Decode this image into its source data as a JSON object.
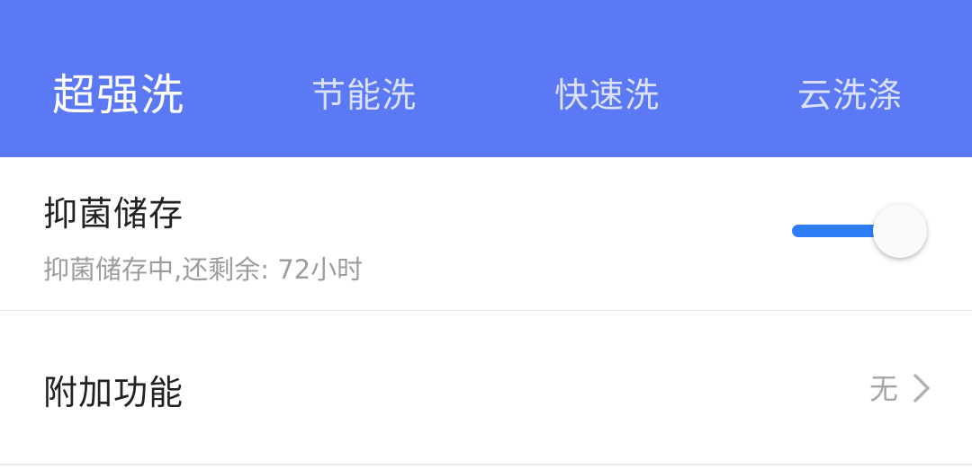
{
  "tabs": [
    {
      "label": "超强洗",
      "active": true
    },
    {
      "label": "节能洗",
      "active": false
    },
    {
      "label": "快速洗",
      "active": false
    },
    {
      "label": "云洗涤",
      "active": false
    }
  ],
  "storage": {
    "title": "抑菌储存",
    "subtitle": "抑菌储存中,还剩余: 72小时",
    "switch_on": true
  },
  "addon": {
    "title": "附加功能",
    "value": "无"
  },
  "icons": {
    "chevron": "chevron-right-icon"
  },
  "colors": {
    "tabbar_bg": "#5b78f5",
    "switch_track": "#2f7df6"
  }
}
